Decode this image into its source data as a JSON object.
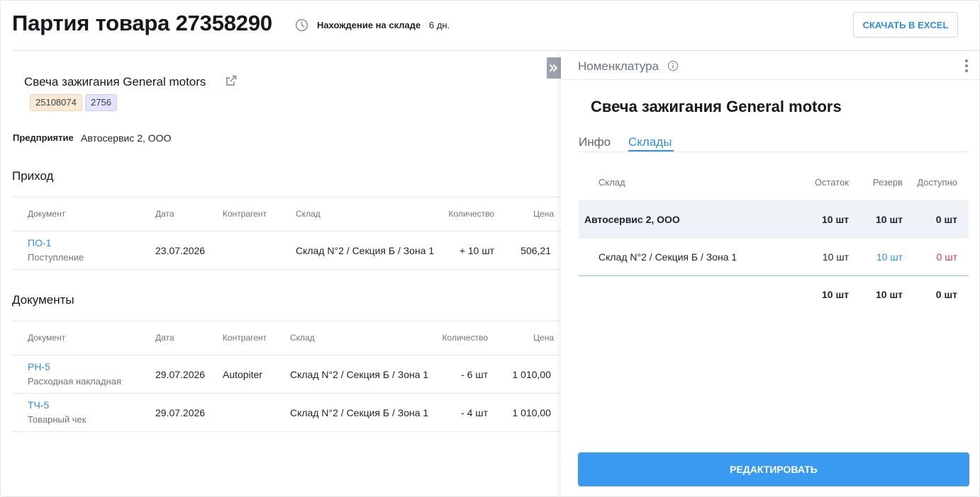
{
  "header": {
    "title": "Партия товара 27358290",
    "stay_label": "Нахождение на складе",
    "stay_value": "6 дн.",
    "excel_button": "СКАЧАТЬ В EXCEL"
  },
  "product": {
    "name": "Свеча зажигания General motors",
    "tags": [
      "25108074",
      "2756"
    ],
    "enterprise_label": "Предприятие",
    "enterprise_value": "Автосервис 2, ООО"
  },
  "income": {
    "title": "Приход",
    "columns": [
      "Документ",
      "Дата",
      "Контрагент",
      "Склад",
      "Количество",
      "Цена"
    ],
    "rows": [
      {
        "doc": "ПО-1",
        "doc_type": "Поступление",
        "date": "23.07.2026",
        "counterparty": "",
        "warehouse": "Склад N°2 / Секция Б / Зона 1",
        "qty": "+ 10 шт",
        "price": "506,21"
      }
    ]
  },
  "documents": {
    "title": "Документы",
    "columns": [
      "Документ",
      "Дата",
      "Контрагент",
      "Склад",
      "Количество",
      "Цена"
    ],
    "rows": [
      {
        "doc": "РН-5",
        "doc_type": "Расходная накладная",
        "date": "29.07.2026",
        "counterparty": "Autopiter",
        "warehouse": "Склад N°2 / Секция Б / Зона 1",
        "qty": "- 6 шт",
        "price": "1 010,00"
      },
      {
        "doc": "ТЧ-5",
        "doc_type": "Товарный чек",
        "date": "29.07.2026",
        "counterparty": "",
        "warehouse": "Склад N°2 / Секция Б / Зона 1",
        "qty": "- 4 шт",
        "price": "1 010,00"
      }
    ]
  },
  "panel": {
    "title": "Номенклатура",
    "product_name": "Свеча зажигания General motors",
    "tabs": [
      "Инфо",
      "Склады"
    ],
    "active_tab": "Склады",
    "columns": [
      "Склад",
      "Остаток",
      "Резерв",
      "Доступно"
    ],
    "group": {
      "name": "Автосервис 2, ООО",
      "stock": "10 шт",
      "reserve": "10 шт",
      "available": "0 шт"
    },
    "rows": [
      {
        "name": "Склад N°2 / Секция Б / Зона 1",
        "stock": "10 шт",
        "reserve": "10 шт",
        "available": "0 шт"
      }
    ],
    "totals": {
      "stock": "10 шт",
      "reserve": "10 шт",
      "available": "0 шт"
    },
    "edit_button": "РЕДАКТИРОВАТЬ"
  },
  "colors": {
    "accent": "#2f8fe0",
    "primary_button": "#3a99f0",
    "negative": "#e2374a",
    "tag_orange": "#fbead3",
    "tag_purple": "#e5e3fb"
  }
}
